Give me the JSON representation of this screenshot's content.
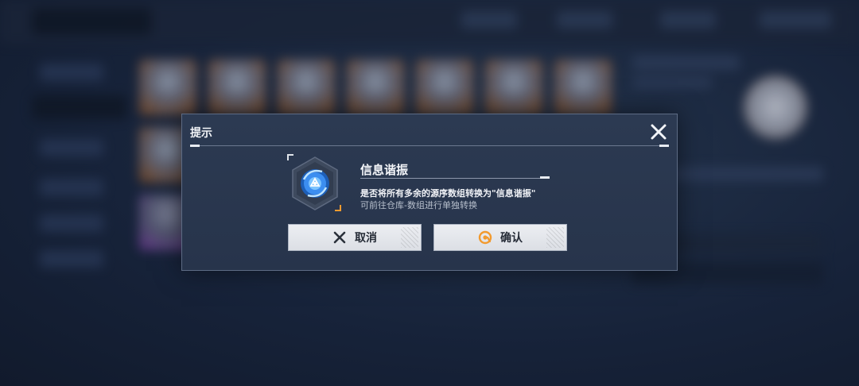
{
  "dialog": {
    "title": "提示",
    "item_name": "信息谐振",
    "message": "是否将所有多余的源序数组转换为\"信息谐振\"",
    "hint": "可前往仓库-数组进行单独转换",
    "cancel_label": "取消",
    "confirm_label": "确认"
  },
  "colors": {
    "accent_orange": "#f29a2e",
    "item_blue": "#4aa8ff",
    "button_bg": "#e4e7ec"
  },
  "icons": {
    "close": "close-icon",
    "cancel": "x-icon",
    "confirm": "confirm-circle-icon",
    "item": "resonance-item-icon"
  }
}
